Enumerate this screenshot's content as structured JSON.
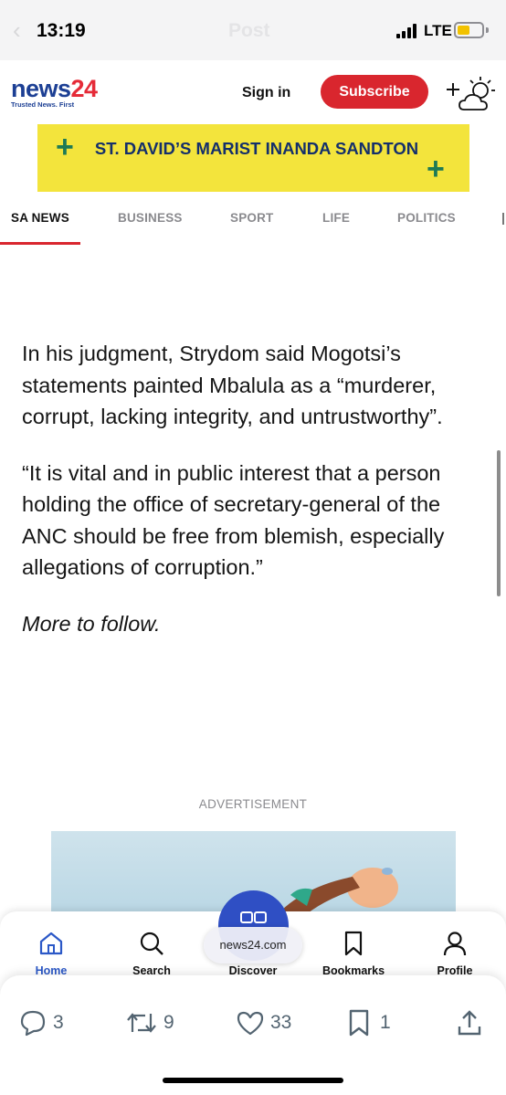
{
  "status_bar": {
    "time": "13:19",
    "ghost_title": "Post",
    "network": "LTE",
    "battery_level": 0.5,
    "battery_color": "#f2c200"
  },
  "header": {
    "logo_part1": "news",
    "logo_part2": "24",
    "tagline": "Trusted News. First",
    "sign_in": "Sign in",
    "subscribe": "Subscribe",
    "weather_icon": "add-weather-icon",
    "accent_color": "#d9262e",
    "logo_color": "#1c3f94"
  },
  "banner": {
    "text": "ST. DAVID’S MARIST INANDA SANDTON",
    "background": "#f3e43c"
  },
  "nav": {
    "tabs": [
      {
        "label": "SA NEWS",
        "active": true
      },
      {
        "label": "BUSINESS",
        "active": false
      },
      {
        "label": "SPORT",
        "active": false
      },
      {
        "label": "LIFE",
        "active": false
      },
      {
        "label": "POLITICS",
        "active": false
      }
    ]
  },
  "article": {
    "paragraphs": [
      "In his judgment, Strydom said Mogotsi’s statements painted Mbalula as a “murderer, corrupt, lacking integrity, and untrustworthy”.",
      "“It is vital and in public interest that a person holding the office of secretary-general of the ANC should be free from blemish, especially allegations of corruption.”",
      "More to follow."
    ]
  },
  "advertisement": {
    "label": "ADVERTISEMENT"
  },
  "app_nav": {
    "items": [
      {
        "label": "Home",
        "icon": "home-icon"
      },
      {
        "label": "Search",
        "icon": "search-icon"
      },
      {
        "label": "Discover",
        "icon": "discover-icon"
      },
      {
        "label": "Bookmarks",
        "icon": "bookmark-icon"
      },
      {
        "label": "Profile",
        "icon": "profile-icon"
      }
    ],
    "url": "news24.com"
  },
  "actions": {
    "replies": "3",
    "reposts": "9",
    "likes": "33",
    "bookmarks": "1",
    "share_icon": "share-icon"
  }
}
